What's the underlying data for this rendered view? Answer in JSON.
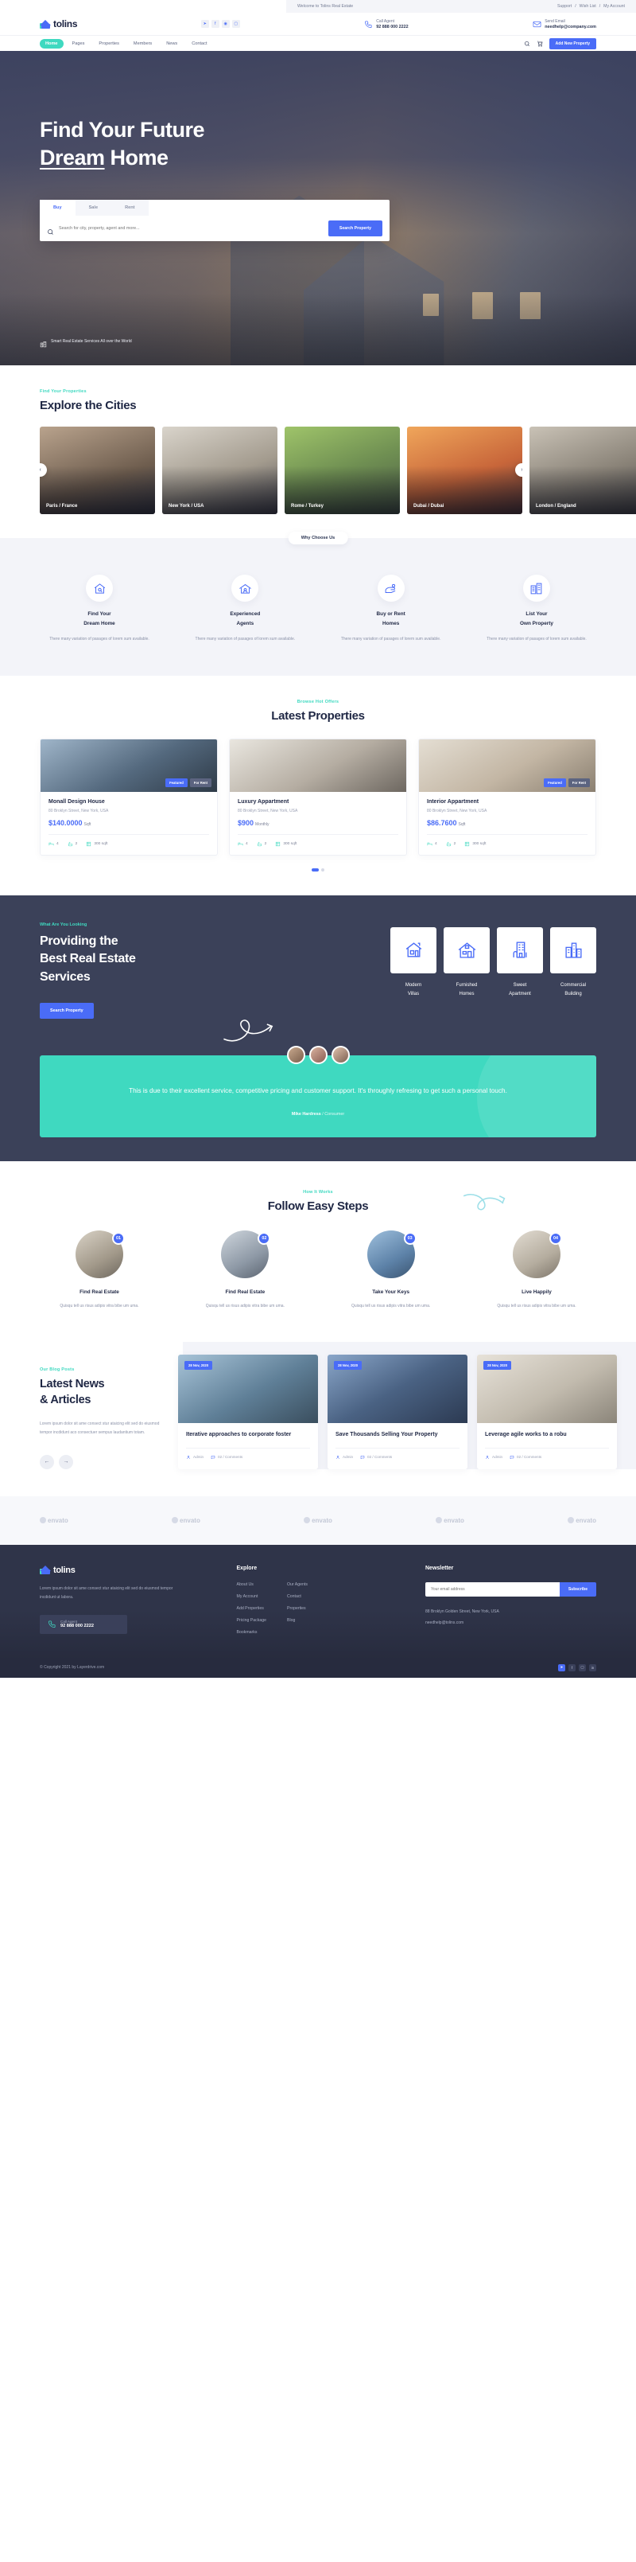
{
  "topbar": {
    "welcome": "Welcome to Tolins Real Estate",
    "links": [
      "Support",
      "Wish List",
      "My Account"
    ],
    "sep": "/"
  },
  "header": {
    "logo": "tolins",
    "socials": [
      "twitter-icon",
      "facebook-icon",
      "dribbble-icon",
      "instagram-icon"
    ],
    "call": {
      "label": "Call Agent",
      "value": "92 888 000 2222"
    },
    "email": {
      "label": "Send Email",
      "value": "needhelp@company.com"
    }
  },
  "nav": {
    "items": [
      {
        "label": "Home",
        "active": true
      },
      {
        "label": "Pages",
        "active": false
      },
      {
        "label": "Properties",
        "active": false
      },
      {
        "label": "Members",
        "active": false
      },
      {
        "label": "News",
        "active": false
      },
      {
        "label": "Contact",
        "active": false
      }
    ],
    "search_icon": "search-icon",
    "cart_icon": "cart-icon",
    "add_property": "Add New Property"
  },
  "hero": {
    "title_line1": "Find Your Future",
    "title_line2_underlined": "Dream",
    "title_line2_rest": " Home",
    "tabs": [
      {
        "label": "Buy",
        "active": true
      },
      {
        "label": "Sale",
        "active": false
      },
      {
        "label": "Rent",
        "active": false
      }
    ],
    "search_placeholder": "Search for city, property, agent and more...",
    "search_button": "Search Property",
    "ticker": "Smart Real Estate Services All over the World"
  },
  "cities": {
    "eyebrow": "Find Your Properties",
    "title": "Explore the Cities",
    "items": [
      {
        "name": "Paris / France"
      },
      {
        "name": "New York / USA"
      },
      {
        "name": "Rome / Turkey"
      },
      {
        "name": "Dubai / Dubai"
      },
      {
        "name": "London / England"
      }
    ],
    "prev": "‹",
    "next": "›"
  },
  "why": {
    "pill": "Why Choose Us",
    "items": [
      {
        "icon": "house-search-icon",
        "title_l1": "Find Your",
        "title_l2": "Dream Home",
        "text": "There many variation of pasages of lorem sum available."
      },
      {
        "icon": "agent-house-icon",
        "title_l1": "Experienced",
        "title_l2": "Agents",
        "text": "There many variation of pasages of lorem sum available."
      },
      {
        "icon": "hand-key-icon",
        "title_l1": "Buy or Rent",
        "title_l2": "Homes",
        "text": "There many variation of pasages of lorem sum available."
      },
      {
        "icon": "building-list-icon",
        "title_l1": "List Your",
        "title_l2": "Own Property",
        "text": "There many variation of pasages of lorem sum available."
      }
    ]
  },
  "properties": {
    "eyebrow": "Browse Hot Offers",
    "title": "Latest Properties",
    "items": [
      {
        "title": "Monall Design House",
        "address": "80 Broklyn Street, New York, USA",
        "price": "$140.0000",
        "unit": "Sqft",
        "badges": [
          {
            "text": "Featured",
            "type": "blue"
          },
          {
            "text": "For Rent",
            "type": "gray"
          }
        ],
        "meta": [
          {
            "icon": "bed-icon",
            "value": "4"
          },
          {
            "icon": "bath-icon",
            "value": "2"
          },
          {
            "icon": "area-icon",
            "value": "300 sqft"
          }
        ]
      },
      {
        "title": "Luxury Appartment",
        "address": "80 Broklyn Street, New York, USA",
        "price": "$900",
        "unit": "Monthly",
        "badges": [],
        "meta": [
          {
            "icon": "bed-icon",
            "value": "4"
          },
          {
            "icon": "bath-icon",
            "value": "2"
          },
          {
            "icon": "area-icon",
            "value": "300 sqft"
          }
        ]
      },
      {
        "title": "Interior Appartment",
        "address": "80 Broklyn Street, New York, USA",
        "price": "$86.7600",
        "unit": "Sqft",
        "badges": [
          {
            "text": "Featured",
            "type": "blue"
          },
          {
            "text": "For Rent",
            "type": "gray"
          }
        ],
        "meta": [
          {
            "icon": "bed-icon",
            "value": "4"
          },
          {
            "icon": "bath-icon",
            "value": "2"
          },
          {
            "icon": "area-icon",
            "value": "300 sqft"
          }
        ]
      }
    ]
  },
  "services": {
    "eyebrow": "What Are You Looking",
    "title_l1": "Providing the",
    "title_l2": "Best Real Estate",
    "title_l3": "Services",
    "button": "Search Property",
    "tiles": [
      {
        "icon": "villa-icon",
        "l1": "Modern",
        "l2": "Villas"
      },
      {
        "icon": "furnished-home-icon",
        "l1": "Furnished",
        "l2": "Homes"
      },
      {
        "icon": "apartment-icon",
        "l1": "Sweet",
        "l2": "Apartment"
      },
      {
        "icon": "commercial-building-icon",
        "l1": "Commercial",
        "l2": "Building"
      }
    ]
  },
  "testimonial": {
    "quote": "This is due to their excellent service, competitive pricing and customer support. It's throughly refresing to get such a personal touch.",
    "author": "Mike Hardress",
    "role": " / Consumer"
  },
  "steps": {
    "eyebrow": "How It Works",
    "title": "Follow Easy Steps",
    "items": [
      {
        "num": "01",
        "title": "Find Real Estate",
        "text": "Quisqu tell us risus adipis vitra bibe um uma."
      },
      {
        "num": "02",
        "title": "Find Real Estate",
        "text": "Quisqu tell us risus adipis vitra bibe um uma."
      },
      {
        "num": "03",
        "title": "Take Your Keys",
        "text": "Quisqu tell us risus adipis vitra bibe um uma."
      },
      {
        "num": "04",
        "title": "Live Happily",
        "text": "Quisqu tell us risus adipis vitra bibe um uma."
      }
    ]
  },
  "news": {
    "eyebrow": "Our Blog Posts",
    "title_l1": "Latest News",
    "title_l2": "& Articles",
    "text": "Lorem ipsum dolor sit ame consect stur ataicing elit sed do eiusmod tempor incdidunt aco consectuer sempus laudantium totam.",
    "prev": "←",
    "next": "→",
    "cards": [
      {
        "date": "28 Nov, 2020",
        "title": "Iterative approaches to corporate foster",
        "author": "Admin",
        "comments": "02 / Comments"
      },
      {
        "date": "28 Nov, 2020",
        "title": "Save Thousands Selling Your Property",
        "author": "Admin",
        "comments": "02 / Comments"
      },
      {
        "date": "28 Nov, 2020",
        "title": "Leverage agile works to a robu",
        "author": "Admin",
        "comments": "02 / Comments"
      }
    ]
  },
  "brands": {
    "items": [
      "envato",
      "envato",
      "envato",
      "envato",
      "envato"
    ]
  },
  "footer": {
    "logo": "tolins",
    "about": "Lorem ipsum dolor sit ame consect stur ataicing elit sed do eiusmod tempor incdidunt ut labora.",
    "call_label": "Call Agent",
    "call_value": "92 888 000 2222",
    "explore_title": "Explore",
    "explore_col1": [
      "About Us",
      "My Account",
      "Add Properties",
      "Pricing Package",
      "Bookmarks"
    ],
    "explore_col2": [
      "Our Agents",
      "Contact",
      "Properties",
      "Blog"
    ],
    "newsletter_title": "Newsletter",
    "newsletter_placeholder": "Your email address",
    "newsletter_button": "Subscribe",
    "address": "88 Broklyn Golden Street, New York, USA",
    "email": "needhelp@tolins.com"
  },
  "copy": {
    "text": "© Copyright 2021 by Layerdrive.com",
    "socials": [
      "twitter-icon",
      "facebook-icon",
      "instagram-icon",
      "linkedin-icon"
    ]
  }
}
